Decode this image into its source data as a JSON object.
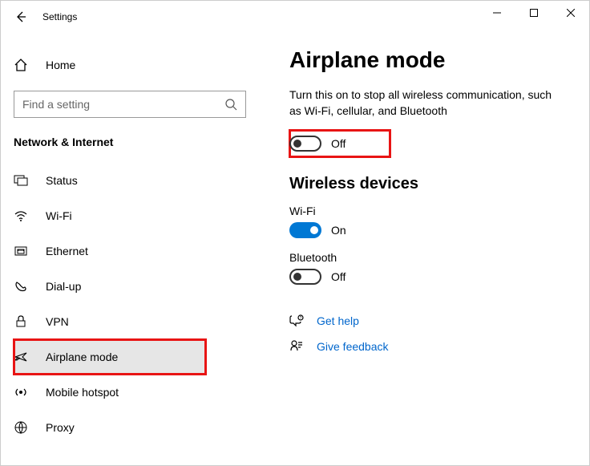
{
  "window": {
    "title": "Settings"
  },
  "sidebar": {
    "home": "Home",
    "search_placeholder": "Find a setting",
    "category": "Network & Internet",
    "items": [
      {
        "label": "Status"
      },
      {
        "label": "Wi-Fi"
      },
      {
        "label": "Ethernet"
      },
      {
        "label": "Dial-up"
      },
      {
        "label": "VPN"
      },
      {
        "label": "Airplane mode"
      },
      {
        "label": "Mobile hotspot"
      },
      {
        "label": "Proxy"
      }
    ]
  },
  "main": {
    "title": "Airplane mode",
    "description": "Turn this on to stop all wireless communication, such as Wi-Fi, cellular, and Bluetooth",
    "airplane_state": "Off",
    "wireless_title": "Wireless devices",
    "wifi_label": "Wi-Fi",
    "wifi_state": "On",
    "bluetooth_label": "Bluetooth",
    "bluetooth_state": "Off",
    "get_help": "Get help",
    "give_feedback": "Give feedback"
  }
}
